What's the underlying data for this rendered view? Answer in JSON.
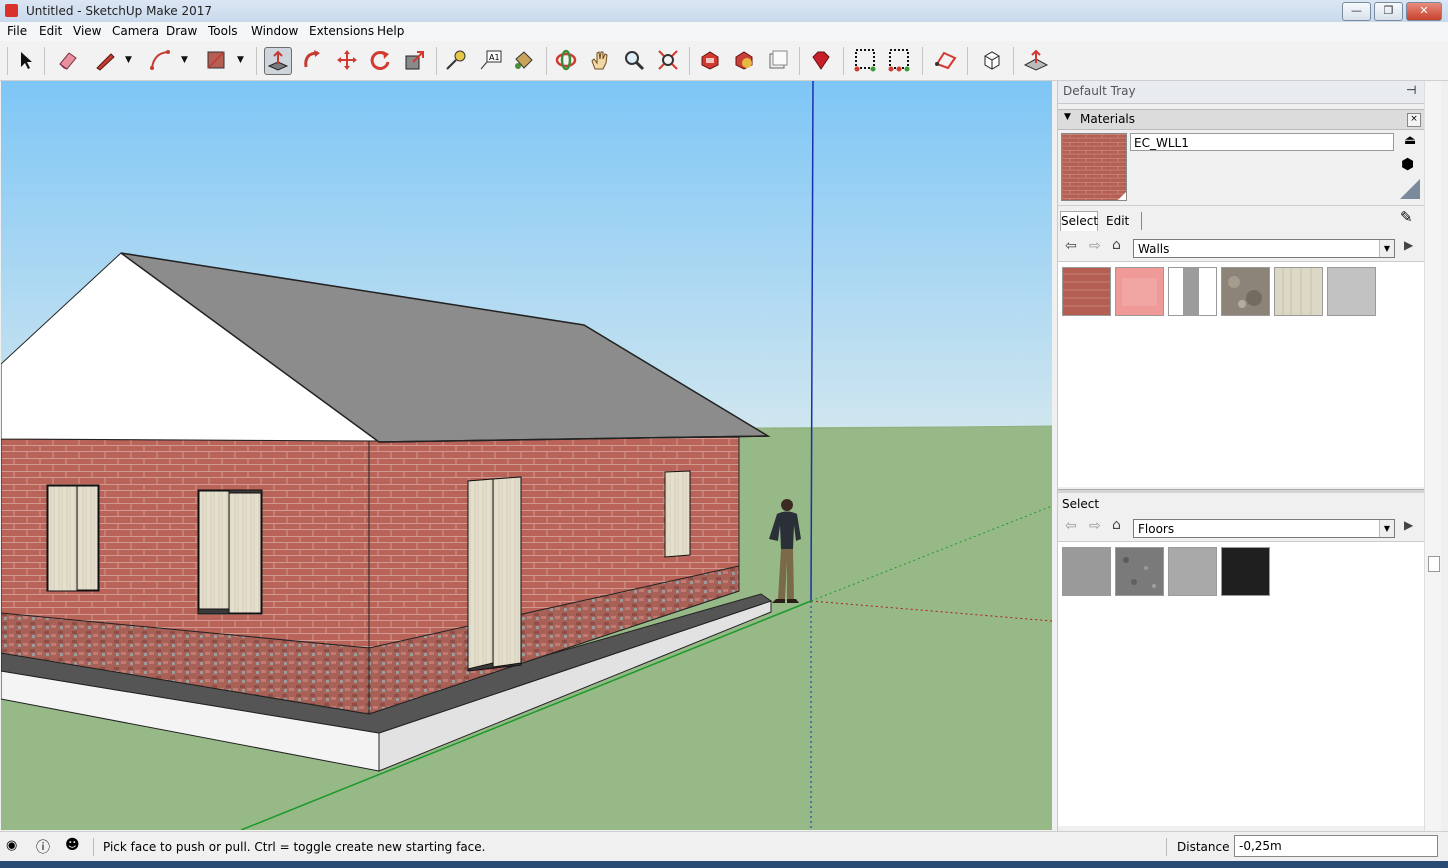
{
  "window": {
    "title": "Untitled - SketchUp Make 2017",
    "min_label": "—",
    "max_label": "❐",
    "close_label": "✕"
  },
  "menu": [
    "File",
    "Edit",
    "View",
    "Camera",
    "Draw",
    "Tools",
    "Window",
    "Extensions",
    "Help"
  ],
  "tray": {
    "title": "Default Tray",
    "materials_panel": {
      "title": "Materials",
      "material_name": "EC_WLL1",
      "tabs": [
        "Select",
        "Edit"
      ],
      "top_library": "Walls",
      "bottom_header": "Select",
      "bottom_library": "Floors",
      "wall_swatch_colors": [
        "#b55e52",
        "#ef9a96",
        "#9c9c9c",
        "#8c8478",
        "#dcd8c6",
        "#c2c2c2"
      ],
      "floor_swatch_colors": [
        "#9a9a9a",
        "#7a7a7a",
        "#a9a9a9",
        "#1f1f1f"
      ]
    }
  },
  "status": {
    "message": "Pick face to push or pull.  Ctrl = toggle create new starting face.",
    "measurement_label": "Distance",
    "measurement_value": "-0,25m"
  },
  "colors": {
    "sky_top": "#7ec6f6",
    "sky_bottom": "#d0e6ef",
    "ground": "#97b987",
    "brick": "#b96359",
    "roof": "#8c8c8c"
  }
}
